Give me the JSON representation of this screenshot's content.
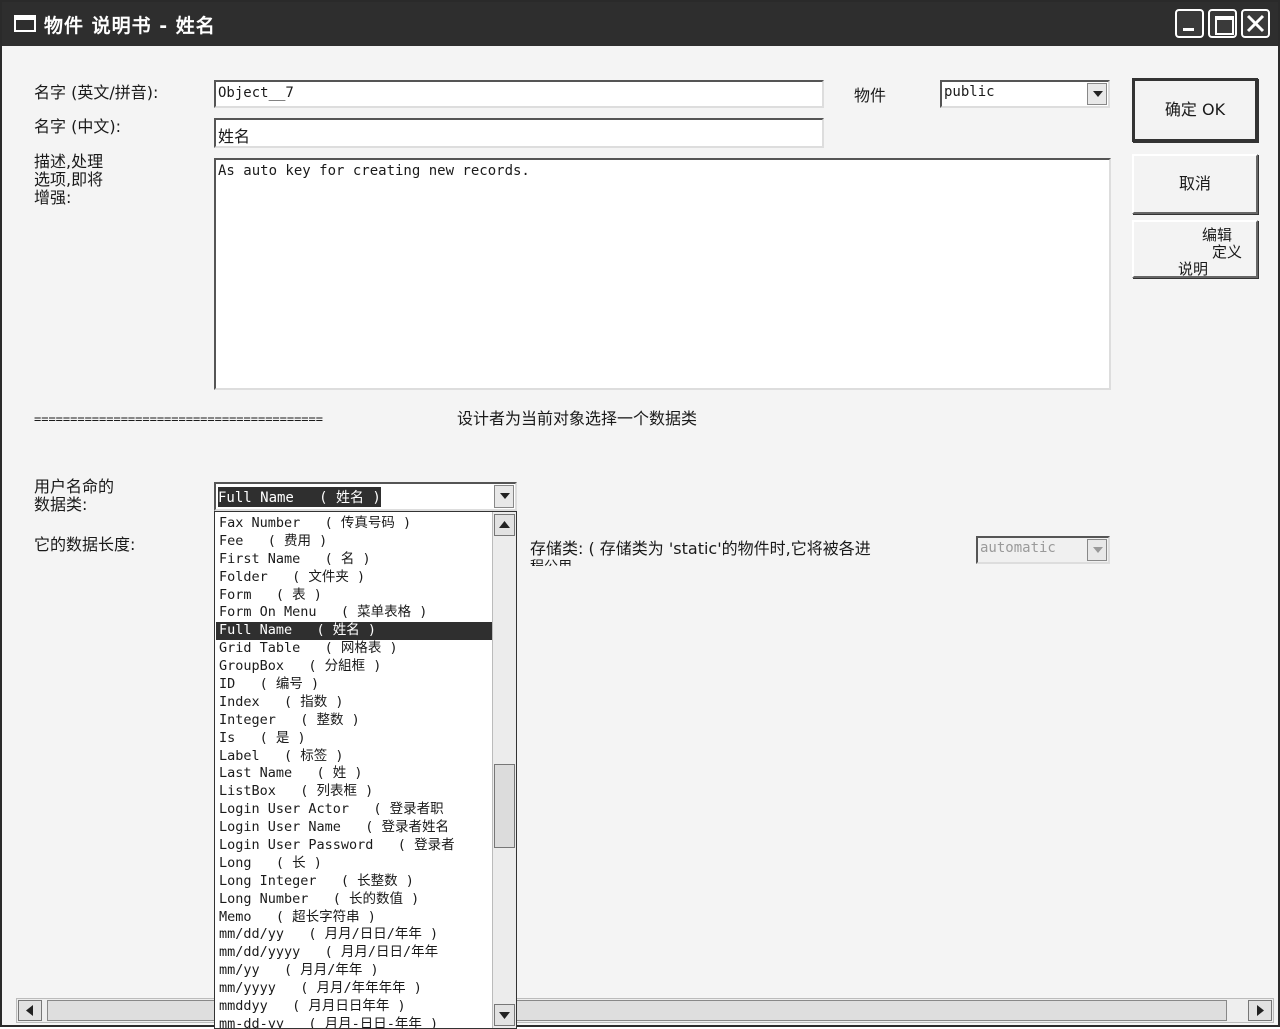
{
  "window": {
    "title": "物件 说明书 - 姓名"
  },
  "form": {
    "name_en_label": "名字 (英文/拼音):",
    "name_en_value": "Object__7",
    "name_cn_label": "名字 (中文):",
    "name_cn_value": "姓名",
    "scope_label": "物件",
    "scope_value": "public",
    "desc_label_line1": "描述,处理",
    "desc_label_line2": "选项,即将",
    "desc_label_line3": "增强:",
    "desc_value": "As auto key for creating new records.",
    "separator": "========================================",
    "designer_hint": "设计者为当前对象选择一个数据类",
    "datatype_label_line1": "用户名命的",
    "datatype_label_line2": "数据类:",
    "datatype_value": "Full Name   ( 姓名 )",
    "length_label": "它的数据长度:",
    "storage_label_line1": "存储类: ( 存储类为 'static'的物件时,它将被各进",
    "storage_label_line2": "程公用、",
    "storage_value": "automatic"
  },
  "buttons": {
    "ok": "确定 OK",
    "cancel": "取消",
    "edit_line1": "编辑",
    "edit_line2": "定义",
    "edit_line3": "说明"
  },
  "dropdown": {
    "items": [
      "Fax Number   ( 传真号码 )",
      "Fee   ( 费用 )",
      "First Name   ( 名 )",
      "Folder   ( 文件夹 )",
      "Form   ( 表 )",
      "Form On Menu   ( 菜单表格 )",
      "Full Name   ( 姓名 )",
      "Grid Table   ( 网格表 )",
      "GroupBox   ( 分組框 )",
      "ID   ( 编号 )",
      "Index   ( 指数 )",
      "Integer   ( 整数 )",
      "Is   ( 是 )",
      "Label   ( 标签 )",
      "Last Name   ( 姓 )",
      "ListBox   ( 列表框 )",
      "Login User Actor   ( 登录者职",
      "Login User Name   ( 登录者姓名",
      "Login User Password   ( 登录者",
      "Long   ( 长 )",
      "Long Integer   ( 长整数 )",
      "Long Number   ( 长的数值 )",
      "Memo   ( 超长字符串 )",
      "mm/dd/yy   ( 月月/日日/年年 )",
      "mm/dd/yyyy   ( 月月/日日/年年",
      "mm/yy   ( 月月/年年 )",
      "mm/yyyy   ( 月月/年年年年 )",
      "mmddyy   ( 月月日日年年 )",
      "mm-dd-yy   ( 月月-日日-年年 )"
    ],
    "selected_index": 6
  },
  "colors": {
    "titlebar": "#2e2e2e",
    "selection": "#2f2f2f"
  }
}
